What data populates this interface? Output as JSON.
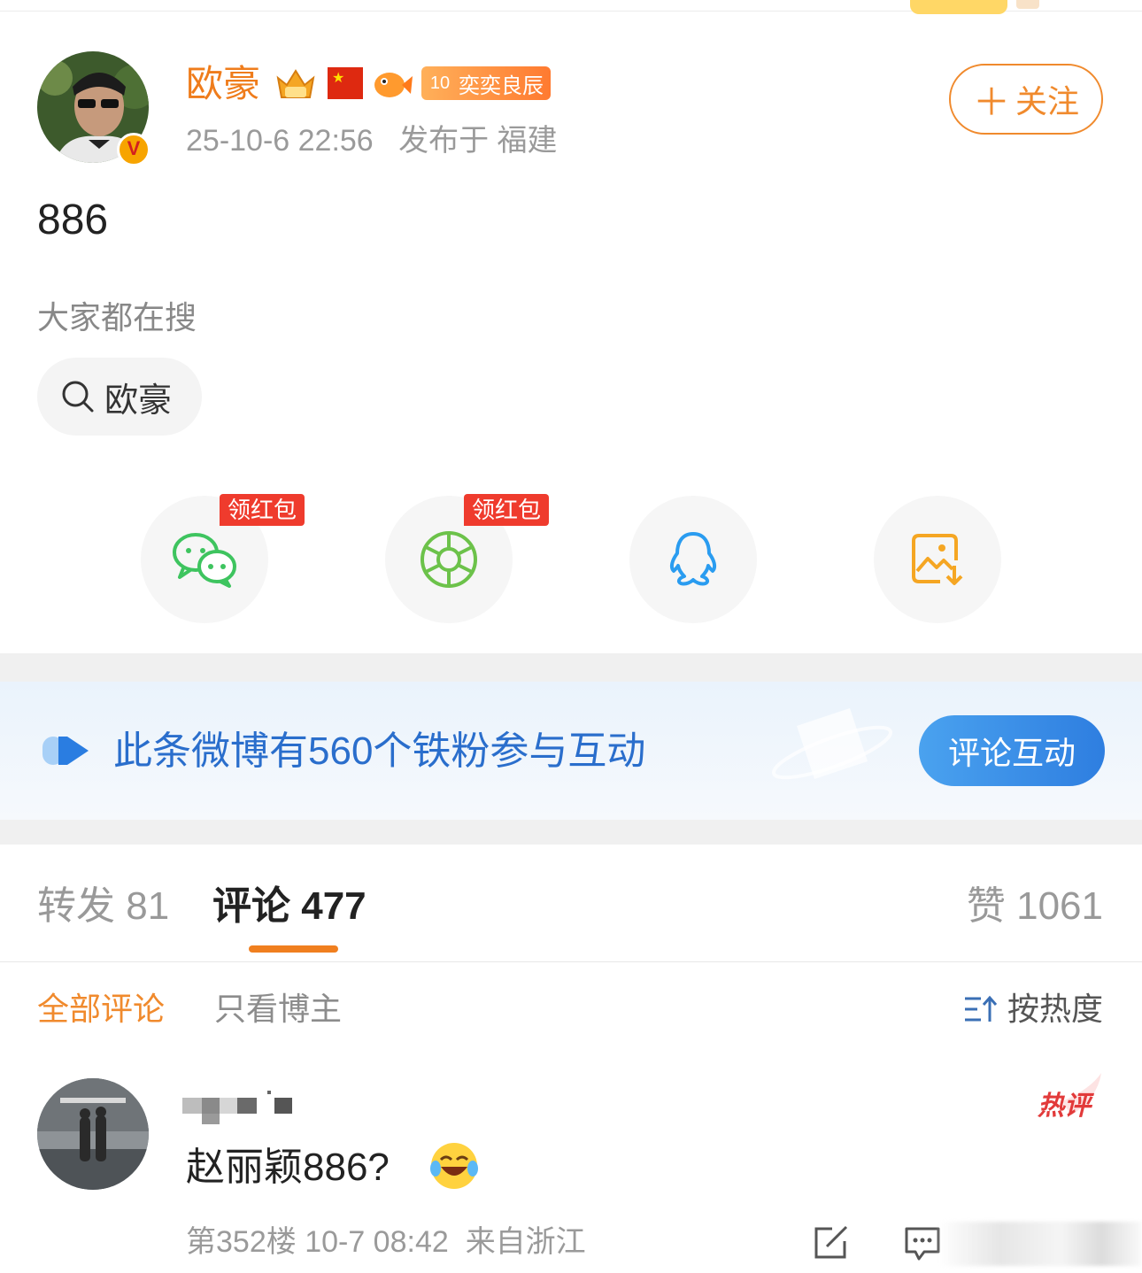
{
  "post": {
    "author": "欧豪",
    "fan_badge_level": "10",
    "fan_badge_label": "奕奕良辰",
    "verified_mark": "V",
    "time": "25-10-6 22:56",
    "location": "发布于 福建",
    "follow_label": "关注",
    "content": "886"
  },
  "search": {
    "title": "大家都在搜",
    "chip": "欧豪"
  },
  "share": {
    "hongbao_label": "领红包",
    "icons": [
      "wechat-icon",
      "moments-icon",
      "qq-icon",
      "save-image-icon"
    ]
  },
  "banner": {
    "text": "此条微博有560个铁粉参与互动",
    "button": "评论互动"
  },
  "tabs": {
    "repost_label": "转发",
    "repost_count": "81",
    "comment_label": "评论",
    "comment_count": "477",
    "like_label": "赞",
    "like_count": "1061"
  },
  "filters": {
    "all": "全部评论",
    "author_only": "只看博主",
    "sort": "按热度"
  },
  "comment": {
    "hot_label": "热评",
    "text": "赵丽颖886?",
    "floor": "第352楼",
    "time": "10-7 08:42",
    "location": "来自浙江"
  },
  "colors": {
    "accent_orange": "#f08a2d",
    "link_blue": "#2a6ecc",
    "hongbao_red": "#ef3b2d"
  }
}
